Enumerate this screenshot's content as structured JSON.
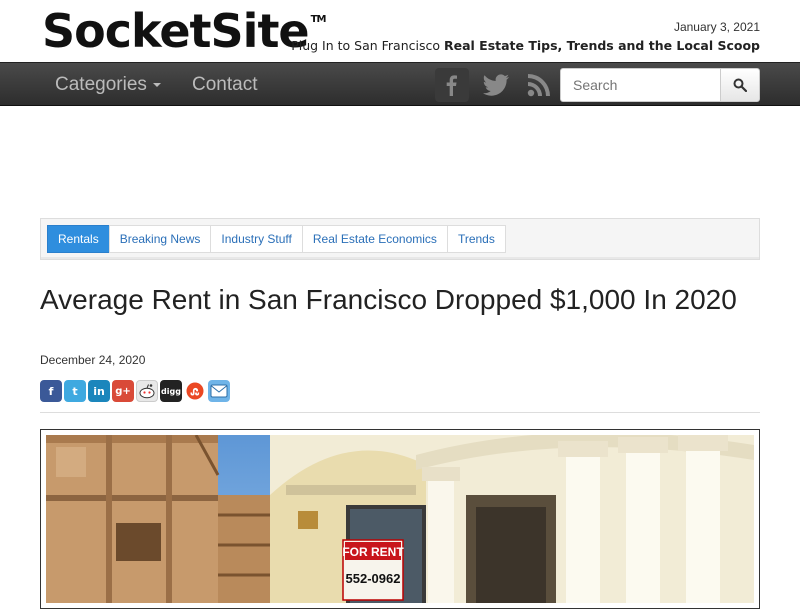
{
  "header": {
    "logo": "SocketSite",
    "trademark": "TM",
    "date": "January 3, 2021",
    "tagline_plain": "Plug In to San Francisco ",
    "tagline_bold": "Real Estate Tips, Trends and the Local Scoop"
  },
  "nav": {
    "categories": "Categories",
    "contact": "Contact",
    "social_icons": [
      "facebook-icon",
      "twitter-icon",
      "rss-icon"
    ],
    "search_placeholder": "Search"
  },
  "tabs": [
    {
      "label": "Rentals",
      "active": true
    },
    {
      "label": "Breaking News",
      "active": false
    },
    {
      "label": "Industry Stuff",
      "active": false
    },
    {
      "label": "Real Estate Economics",
      "active": false
    },
    {
      "label": "Trends",
      "active": false
    }
  ],
  "article": {
    "title": "Average Rent in San Francisco Dropped $1,000 In 2020",
    "date": "December 24, 2020",
    "share_icons": [
      "facebook-icon",
      "twitter-icon",
      "linkedin-icon",
      "google-plus-icon",
      "reddit-icon",
      "digg-icon",
      "stumbleupon-icon",
      "email-icon"
    ],
    "photo_sign_title": "FOR RENT",
    "photo_sign_phone": "552-0962"
  },
  "colors": {
    "accent": "#2f8ede",
    "link": "#2a6fb8",
    "navbar": "#333333"
  }
}
